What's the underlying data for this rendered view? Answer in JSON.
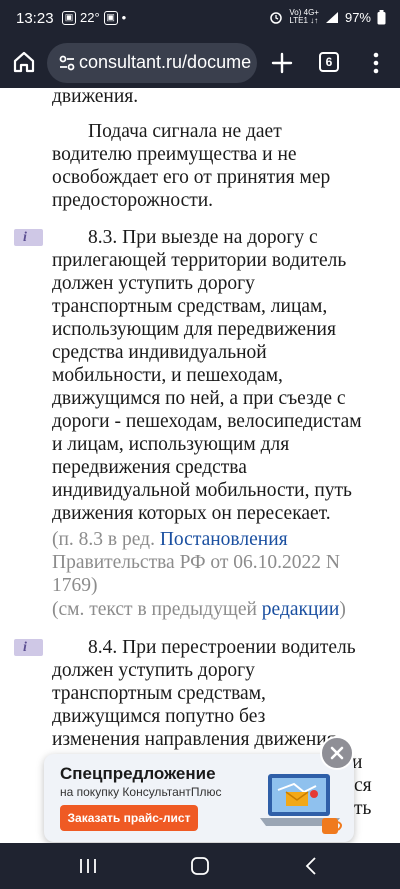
{
  "status_bar": {
    "time": "13:23",
    "temperature": "22°",
    "dot": "•",
    "network": "Vo) 4G+\nLTE1 ↓↑",
    "battery": "97%"
  },
  "browser": {
    "url": "consultant.ru/docume",
    "tab_count": "6"
  },
  "document": {
    "lines": [
      "движения.",
      "Подача сигнала не дает",
      "водителю преимущества и не",
      "освобождает его от принятия мер",
      "предосторожности.",
      "8.3. При выезде на дорогу с",
      "прилегающей территории водитель",
      "должен уступить дорогу",
      "транспортным средствам, лицам,",
      "использующим для передвижения",
      "средства индивидуальной",
      "мобильности, и пешеходам,",
      "движущимся по ней, а при съезде с",
      "дороги - пешеходам, велосипедистам",
      "и лицам, использующим для",
      "передвижения средства",
      "индивидуальной мобильности, путь",
      "движения которых он пересекает.",
      "8.4. При перестроении водитель",
      "должен уступить дорогу",
      "транспортным средствам,",
      "движущимся попутно без",
      "изменения направления движения.",
      "и",
      "ся",
      "ть"
    ],
    "note_83": {
      "prefix": "(п. 8.3 в ред. ",
      "link": "Постановления",
      "line2": "Правительства РФ от 06.10.2022 N",
      "line3": "1769)"
    },
    "see_prev": {
      "prefix": "(см. текст в предыдущей ",
      "link": "редакции",
      "suffix": ")"
    },
    "info_icon_glyph": "i"
  },
  "promo": {
    "title": "Спецпредложение",
    "subtitle": "на покупку КонсультантПлюс",
    "button": "Заказать прайс-лист"
  },
  "colors": {
    "system_bar": "#1f2330",
    "link": "#1a4fa0",
    "note_grey": "#8c8c8c",
    "info_badge": "#cfc8e6",
    "cta": "#ef5a24"
  },
  "icons": {
    "home": "home-icon",
    "site_settings": "tune-icon",
    "new_tab": "plus-icon",
    "tabs": "tab-switcher-icon",
    "menu": "more-vert-icon",
    "close": "close-icon",
    "recents": "recents-icon",
    "home_nav": "nav-home-icon",
    "back": "back-icon"
  }
}
